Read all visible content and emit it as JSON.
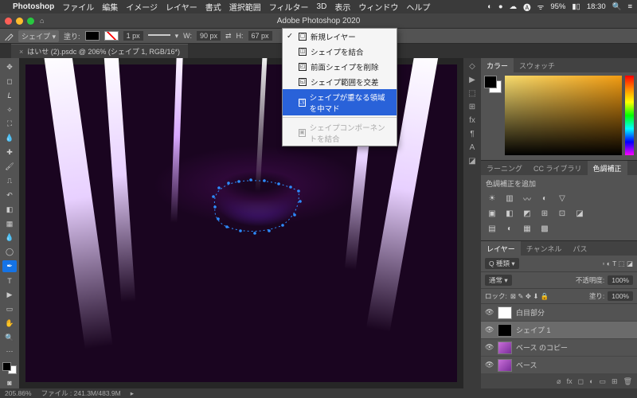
{
  "menubar": {
    "apple_icon": "",
    "app": "Photoshop",
    "items": [
      "ファイル",
      "編集",
      "イメージ",
      "レイヤー",
      "書式",
      "選択範囲",
      "フィルター",
      "3D",
      "表示",
      "ウィンドウ",
      "ヘルプ"
    ],
    "status": {
      "battery_pct": "95%",
      "time": "18:30"
    }
  },
  "window": {
    "title": "Adobe Photoshop 2020"
  },
  "options_bar": {
    "tool_mode": "シェイプ",
    "fill_label": "塗り:",
    "stroke_width": "1 px",
    "w_label": "W:",
    "w_val": "90 px",
    "h_label": "H:",
    "h_val": "67 px"
  },
  "tab": {
    "label": "はいせ (2).psdc @ 206% (シェイプ 1, RGB/16*)"
  },
  "dropdown": {
    "items": [
      {
        "label": "新規レイヤー",
        "checked": true,
        "hl": false,
        "dim": false
      },
      {
        "label": "シェイプを結合",
        "checked": false,
        "hl": false,
        "dim": false
      },
      {
        "label": "前面シェイプを削除",
        "checked": false,
        "hl": false,
        "dim": false
      },
      {
        "label": "シェイプ範囲を交差",
        "checked": false,
        "hl": false,
        "dim": false
      },
      {
        "label": "シェイプが重なる領域を中マド",
        "checked": false,
        "hl": true,
        "dim": false
      }
    ],
    "disabled": {
      "label": "シェイプコンポーネントを結合"
    }
  },
  "panels": {
    "color_tabs": [
      "カラー",
      "スウォッチ"
    ],
    "adjust_tabs": [
      "ラーニング",
      "CC ライブラリ",
      "色調補正"
    ],
    "adjust_title": "色調補正を追加",
    "layers_tabs": [
      "レイヤー",
      "チャンネル",
      "パス"
    ],
    "blend_label": "Q 種類",
    "opacity_label": "不透明度:",
    "opacity_val": "100%",
    "lock_label": "ロック:",
    "fill_label": "塗り:",
    "fill_val": "100%"
  },
  "layers": [
    {
      "name": "白目部分",
      "visible": true,
      "selected": false,
      "thumb": "#fff"
    },
    {
      "name": "シェイプ 1",
      "visible": true,
      "selected": true,
      "thumb": "#000"
    },
    {
      "name": "ベース のコピー",
      "visible": true,
      "selected": false,
      "thumb": "linear-gradient(135deg,#c86ed8,#7a2e9a)"
    },
    {
      "name": "ベース",
      "visible": true,
      "selected": false,
      "thumb": "linear-gradient(135deg,#c86ed8,#7a2e9a)"
    }
  ],
  "status": {
    "zoom": "205.86%",
    "doc": "ファイル : 241.3M/483.9M"
  }
}
